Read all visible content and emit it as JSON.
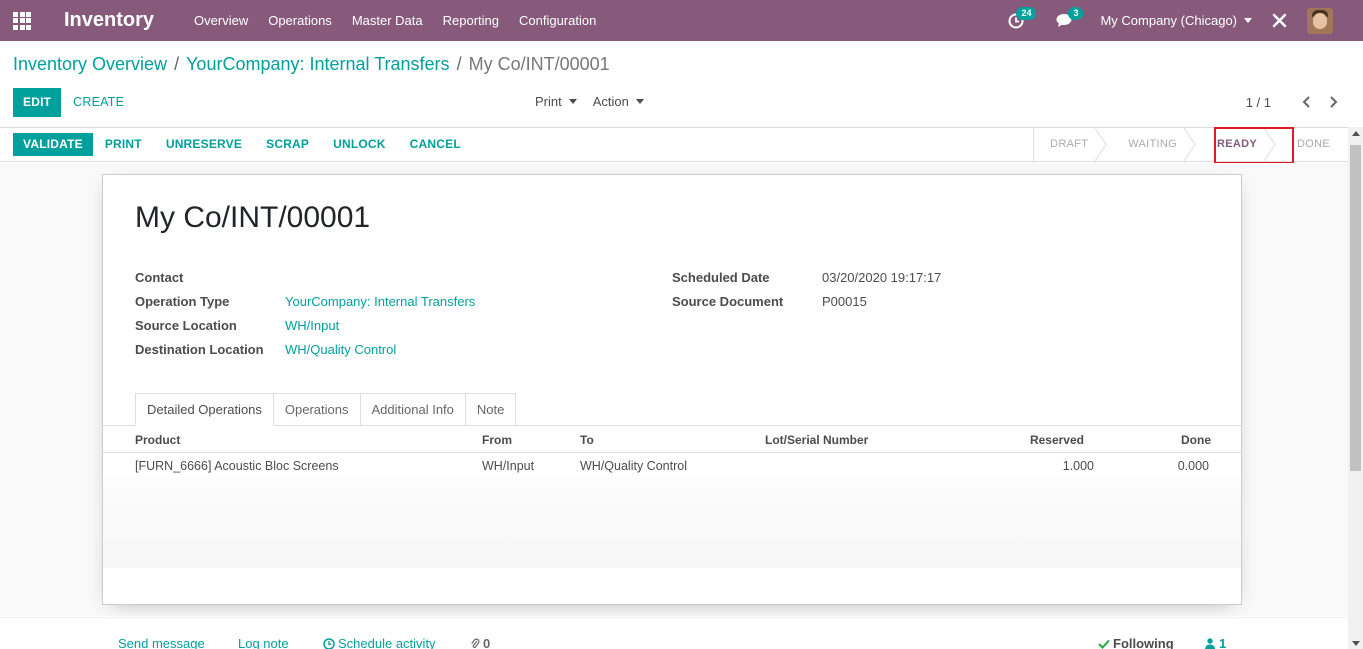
{
  "navbar": {
    "app_name": "Inventory",
    "menu": [
      "Overview",
      "Operations",
      "Master Data",
      "Reporting",
      "Configuration"
    ],
    "activity_count": "24",
    "message_count": "3",
    "company": "My Company (Chicago)"
  },
  "breadcrumb": {
    "items": [
      "Inventory Overview",
      "YourCompany: Internal Transfers"
    ],
    "current": "My Co/INT/00001"
  },
  "control_panel": {
    "edit_label": "EDIT",
    "create_label": "CREATE",
    "print_label": "Print",
    "action_label": "Action",
    "pager": "1 / 1"
  },
  "status_buttons": [
    "VALIDATE",
    "PRINT",
    "UNRESERVE",
    "SCRAP",
    "UNLOCK",
    "CANCEL"
  ],
  "states": [
    {
      "label": "DRAFT",
      "active": false
    },
    {
      "label": "WAITING",
      "active": false
    },
    {
      "label": "READY",
      "active": true
    },
    {
      "label": "DONE",
      "active": false
    }
  ],
  "form": {
    "title": "My Co/INT/00001",
    "contact_label": "Contact",
    "contact_value": "",
    "operation_type_label": "Operation Type",
    "operation_type_value": "YourCompany: Internal Transfers",
    "source_location_label": "Source Location",
    "source_location_value": "WH/Input",
    "destination_location_label": "Destination Location",
    "destination_location_value": "WH/Quality Control",
    "scheduled_date_label": "Scheduled Date",
    "scheduled_date_value": "03/20/2020 19:17:17",
    "source_document_label": "Source Document",
    "source_document_value": "P00015"
  },
  "tabs": [
    {
      "label": "Detailed Operations",
      "active": true
    },
    {
      "label": "Operations",
      "active": false
    },
    {
      "label": "Additional Info",
      "active": false
    },
    {
      "label": "Note",
      "active": false
    }
  ],
  "table": {
    "columns": [
      "Product",
      "From",
      "To",
      "Lot/Serial Number",
      "Reserved",
      "Done"
    ],
    "rows": [
      {
        "product": "[FURN_6666] Acoustic Bloc Screens",
        "from": "WH/Input",
        "to": "WH/Quality Control",
        "lot": "",
        "reserved": "1.000",
        "done": "0.000"
      }
    ]
  },
  "chatter": {
    "send_message": "Send message",
    "log_note": "Log note",
    "schedule_activity": "Schedule activity",
    "attachments": "0",
    "following": "Following",
    "followers": "1"
  },
  "colors": {
    "navbar": "#875a7b",
    "accent": "#00a09d",
    "highlight": "#e01a29"
  }
}
